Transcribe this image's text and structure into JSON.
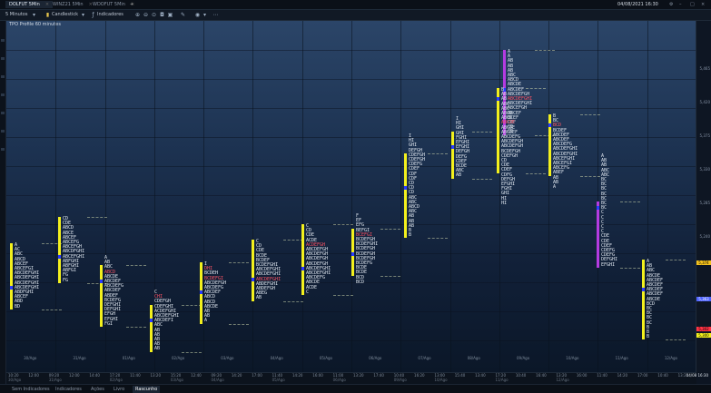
{
  "tabs": [
    {
      "label": "DOLFUT 5Min",
      "active": true
    },
    {
      "label": "WINZ21 5Min",
      "active": false
    },
    {
      "label": "WDOFUT 5Min",
      "active": false
    }
  ],
  "datetime": "04/08/2021 16:30",
  "toolbar": {
    "timeframe": "5 Minutos",
    "chart_style": "Candlestick",
    "indicators": "Indicadores"
  },
  "chart_title": "TPO Profile 60 minutes",
  "price_ticks": [
    "5,465",
    "5,420",
    "5,375",
    "5,330",
    "5,285",
    "5,240"
  ],
  "price_labels": [
    {
      "text": "5,374",
      "color": "#f3c11d"
    },
    {
      "text": "5,363",
      "color": "#4f64ff"
    },
    {
      "text": "5,302",
      "color": "#ff3344"
    },
    {
      "text": "5,300",
      "color": "#f3f01d"
    }
  ],
  "day_labels": [
    "30/Ago",
    "31/Ago",
    "01/Ago",
    "02/Ago",
    "03/Ago",
    "04/Ago",
    "05/Ago",
    "06/Ago",
    "07/Ago",
    "08/Ago",
    "09/Ago",
    "10/Ago",
    "11/Ago",
    "12/Ago"
  ],
  "time_labels": [
    {
      "t": "10:20",
      "d": "30/Ago"
    },
    {
      "t": "12:00",
      "d": ""
    },
    {
      "t": "09:20",
      "d": "31/Ago"
    },
    {
      "t": "12:00",
      "d": ""
    },
    {
      "t": "14:40",
      "d": ""
    },
    {
      "t": "17:20",
      "d": "02/Ago"
    },
    {
      "t": "11:40",
      "d": ""
    },
    {
      "t": "13:20",
      "d": ""
    },
    {
      "t": "15:20",
      "d": "03/Ago"
    },
    {
      "t": "12:40",
      "d": ""
    },
    {
      "t": "09:20",
      "d": "04/Ago"
    },
    {
      "t": "14:20",
      "d": ""
    },
    {
      "t": "17:00",
      "d": ""
    },
    {
      "t": "11:40",
      "d": "05/Ago"
    },
    {
      "t": "14:20",
      "d": ""
    },
    {
      "t": "16:00",
      "d": ""
    },
    {
      "t": "11:00",
      "d": "06/Ago"
    },
    {
      "t": "13:20",
      "d": ""
    },
    {
      "t": "17:40",
      "d": ""
    },
    {
      "t": "10:40",
      "d": "09/Ago"
    },
    {
      "t": "16:20",
      "d": ""
    },
    {
      "t": "13:00",
      "d": "10/Ago"
    },
    {
      "t": "15:40",
      "d": ""
    },
    {
      "t": "13:40",
      "d": ""
    },
    {
      "t": "17:20",
      "d": "11/Ago"
    },
    {
      "t": "10:40",
      "d": ""
    },
    {
      "t": "16:40",
      "d": ""
    },
    {
      "t": "13:20",
      "d": "12/Ago"
    },
    {
      "t": "16:00",
      "d": ""
    },
    {
      "t": "11:40",
      "d": ""
    },
    {
      "t": "14:20",
      "d": ""
    },
    {
      "t": "17:00",
      "d": ""
    },
    {
      "t": "10:40",
      "d": ""
    },
    {
      "t": "13:20",
      "d": ""
    }
  ],
  "bottom_tabs": [
    {
      "label": "Sem Indicadores",
      "active": false
    },
    {
      "label": "Indicadores",
      "active": false
    },
    {
      "label": "Ações",
      "active": false
    },
    {
      "label": "Livro",
      "active": false
    },
    {
      "label": "Rascunho",
      "active": true
    }
  ],
  "clock": "04/08 16:30",
  "profiles": [
    {
      "rows": [
        "A",
        "AC",
        "ABC",
        "ABCD",
        "ABCEF",
        "ABCEFGI",
        "ABCDEFGHI",
        "ABCDEFGHI",
        "ABCDEFGHI",
        "ABCDEFGHI",
        "ABDFGHI",
        "ABCEF",
        "ABD",
        "BD"
      ]
    },
    {
      "rows": [
        "CD",
        "CDE",
        "ABCD",
        "ABCE",
        "ABCEF",
        "ABCEFG",
        "ABCEFGH",
        "ABCDFGHI",
        "ABCEFGHI",
        "ABFGHI",
        "ABFGHI",
        "ABFGI",
        "FG",
        "FG"
      ]
    },
    {
      "rows": [
        "A",
        "AB",
        "ABC",
        "ABCD",
        "ABCDE",
        "ABCDEF",
        "ABCDEFG",
        "ABCDEF",
        "ABDEF",
        "BCDEFG",
        "DEFGHI",
        "DEFGHI",
        "EFGH",
        "EFGHI",
        "FGI"
      ]
    },
    {
      "rows": [
        "C",
        "CHI",
        "CDEFGH",
        "CDEFGHI",
        "ACDEFGHI",
        "ABCDEFGHI",
        "ABCDEFI",
        "ABC",
        "AB",
        "AB",
        "AB",
        "AB",
        "AB"
      ]
    },
    {
      "rows": [
        "I",
        "DHI",
        "BCDEH",
        "BCDEFGI",
        "ABCDEFGH",
        "ABCDEFG",
        "ABCDEF",
        "ABCD",
        "ABCD",
        "ABCDE",
        "AB",
        "AB",
        "A"
      ]
    },
    {
      "rows": [
        "C",
        "CD",
        "CDE",
        "BCDE",
        "BCDEF",
        "BCDEFGHI",
        "ABCDEFGHI",
        "ABCDEFGHI",
        "ABCDEFGHI",
        "ABDEFGHI",
        "ABDEFGH",
        "ABEG",
        "AB"
      ]
    },
    {
      "rows": [
        "C",
        "CD",
        "CDE",
        "ACDE",
        "ACDEFGH",
        "ABCDEFGH",
        "ABCDEFGH",
        "ABCDEFGH",
        "ABCDEFGH",
        "ABCDEFGHI",
        "ABCDEFGHI",
        "ABCDEFG",
        "ABCDE",
        "ACDE",
        "C"
      ]
    },
    {
      "rows": [
        "F",
        "EF",
        "EFG",
        "BEFGI",
        "BCEFGI",
        "BCDEFGH",
        "BCDEFGHI",
        "BCDEFGH",
        "BCDEFGH",
        "BCDEFGH",
        "BCDEFG",
        "BCDE",
        "BCDE",
        "BCD",
        "BCD"
      ]
    },
    {
      "rows": [
        "I",
        "HI",
        "GHI",
        "DEFGH",
        "CDEFGH",
        "CDEFGH",
        "CDEFG",
        "CDEF",
        "CDF",
        "CDF",
        "CD",
        "CD",
        "CD",
        "ABC",
        "ABC",
        "ABCD",
        "ABC",
        "AB",
        "AB",
        "AB",
        "B",
        "B"
      ]
    },
    {
      "rows": [
        "I",
        "HI",
        "GHI",
        "GHI",
        "FGHI",
        "EFGHI",
        "EFGHI",
        "DEFGH",
        "DEFG",
        "CDEF",
        "BCDE",
        "ABC",
        "AB"
      ]
    },
    {
      "rows": [
        "A",
        "A",
        "AB",
        "AB",
        "AB",
        "ABC",
        "ABCD",
        "ABCDE",
        "ABCDEF",
        "ABCDEFGH",
        "ABCDEFGHI",
        "ABCDEFGHI",
        "ABCEFGH",
        "ABCEF",
        "BCEF",
        "CEF",
        "CE",
        "CE"
      ]
    },
    {
      "rows": [
        "B",
        "AB",
        "AB",
        "ABC",
        "ABC",
        "ABCD",
        "ABCD",
        "ABCDE",
        "ABCDE",
        "ABCDEF",
        "ABCDEFG",
        "ABCDEFGH",
        "ABCDEFGH",
        "BCDEFGH",
        "CDEFGH",
        "CD",
        "CDE",
        "CDEF",
        "CDFG",
        "DEFGH",
        "EFGHI",
        "FGHI",
        "GHI",
        "HI",
        "HI"
      ]
    },
    {
      "rows": [
        "B",
        "BC",
        "BCD",
        "BCDEF",
        "ABCDEF",
        "ABCDEF",
        "ABCDEFG",
        "ABCDEFGHI",
        "ABCDEFGHI",
        "ABCEFGHI",
        "ABCEFGI",
        "ABCEFG",
        "ABEF",
        "AB",
        "AB",
        "A"
      ]
    },
    {
      "rows": [
        "A",
        "AB",
        "AB",
        "ABC",
        "ABC",
        "BC",
        "BC",
        "BC",
        "BC",
        "BC",
        "BC",
        "BC",
        "C",
        "C",
        "C",
        "C",
        "C",
        "CDE",
        "CDE",
        "CDEF",
        "CDEFG",
        "CDEFG",
        "DEFGHI",
        "EFGHI"
      ]
    },
    {
      "rows": [
        "A",
        "AB",
        "ABC",
        "ABCDE",
        "ABCDEF",
        "ABCDEF",
        "ABCDEF",
        "ABCDEF",
        "ABCDE",
        "BCD",
        "BC",
        "BC",
        "BC",
        "BC",
        "B",
        "B",
        "B"
      ]
    }
  ]
}
